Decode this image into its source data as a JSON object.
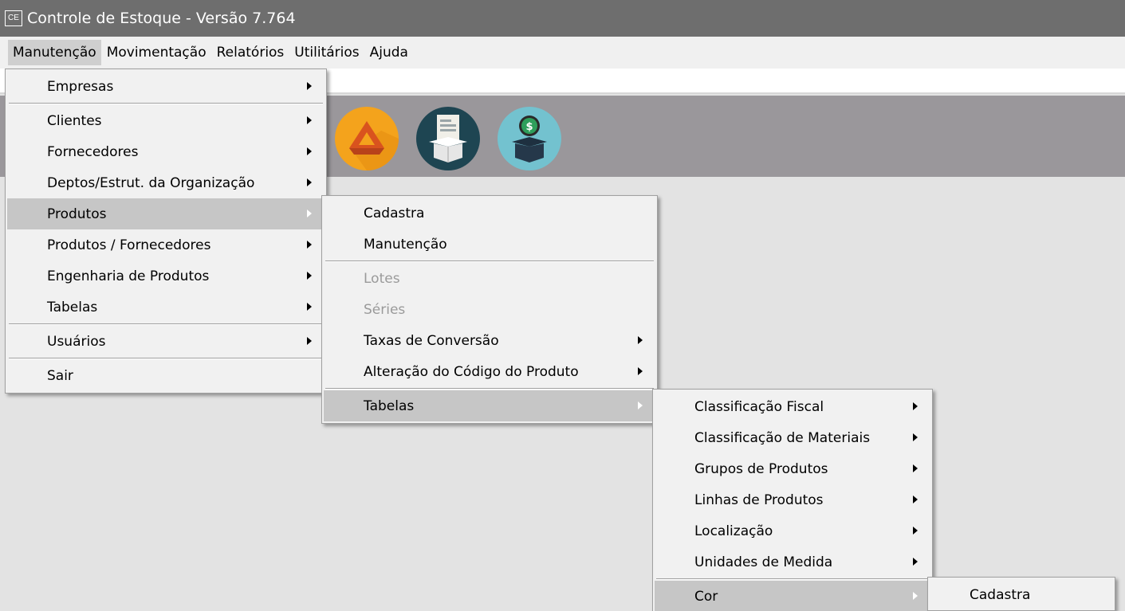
{
  "titlebar": {
    "icon_text": "CE",
    "title": "Controle de Estoque - Versão 7.764"
  },
  "menubar": {
    "items": [
      {
        "label": "Manutenção",
        "active": true
      },
      {
        "label": "Movimentação"
      },
      {
        "label": "Relatórios"
      },
      {
        "label": "Utilitários"
      },
      {
        "label": "Ajuda"
      }
    ]
  },
  "toolbar": {
    "icons": [
      "box-hammer-icon",
      "box-document-icon",
      "box-money-icon"
    ],
    "colors": [
      "#f4a31c",
      "#1e4552",
      "#73c2cf"
    ]
  },
  "menu1": {
    "items": [
      {
        "label": "Empresas",
        "submenu": true
      },
      {
        "label": "Clientes",
        "submenu": true
      },
      {
        "label": "Fornecedores",
        "submenu": true
      },
      {
        "label": "Deptos/Estrut. da Organização",
        "submenu": true
      },
      {
        "label": "Produtos",
        "submenu": true,
        "highlighted": true
      },
      {
        "label": "Produtos / Fornecedores",
        "submenu": true
      },
      {
        "label": "Engenharia de Produtos",
        "submenu": true
      },
      {
        "label": "Tabelas",
        "submenu": true
      },
      {
        "label": "Usuários",
        "submenu": true
      },
      {
        "label": "Sair"
      }
    ]
  },
  "menu2": {
    "items": [
      {
        "label": "Cadastra"
      },
      {
        "label": "Manutenção"
      },
      {
        "label": "Lotes",
        "disabled": true
      },
      {
        "label": "Séries",
        "disabled": true
      },
      {
        "label": "Taxas de Conversão",
        "submenu": true
      },
      {
        "label": "Alteração do Código do Produto",
        "submenu": true
      },
      {
        "label": "Tabelas",
        "submenu": true,
        "highlighted": true
      }
    ]
  },
  "menu3": {
    "items": [
      {
        "label": "Classificação Fiscal",
        "submenu": true
      },
      {
        "label": "Classificação de Materiais",
        "submenu": true
      },
      {
        "label": "Grupos de Produtos",
        "submenu": true
      },
      {
        "label": "Linhas de Produtos",
        "submenu": true
      },
      {
        "label": "Localização",
        "submenu": true
      },
      {
        "label": "Unidades de Medida",
        "submenu": true
      },
      {
        "label": "Cor",
        "submenu": true,
        "highlighted": true
      }
    ]
  },
  "menu4": {
    "items": [
      {
        "label": "Cadastra"
      }
    ]
  }
}
